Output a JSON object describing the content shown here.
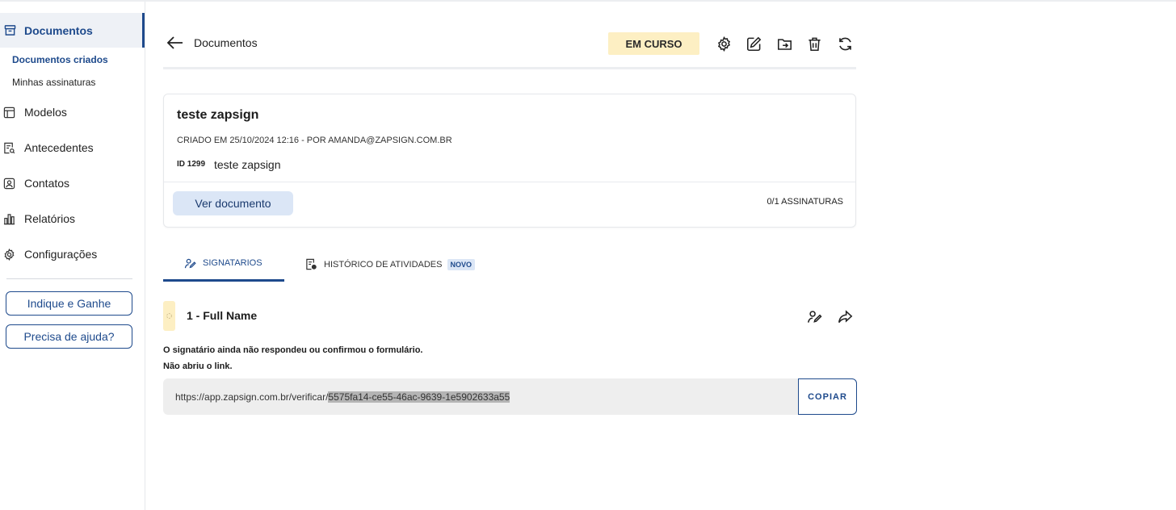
{
  "sidebar": {
    "active": {
      "label": "Documentos",
      "icon": "archive-icon"
    },
    "subitems": [
      {
        "label": "Documentos criados",
        "active": true
      },
      {
        "label": "Minhas assinaturas",
        "active": false
      }
    ],
    "items": [
      {
        "label": "Modelos",
        "icon": "template-icon"
      },
      {
        "label": "Antecedentes",
        "icon": "document-search-icon"
      },
      {
        "label": "Contatos",
        "icon": "contact-icon"
      },
      {
        "label": "Relatórios",
        "icon": "bar-chart-icon"
      },
      {
        "label": "Configurações",
        "icon": "gear-icon"
      }
    ],
    "refer_button": "Indique e Ganhe",
    "help_button": "Precisa de ajuda?"
  },
  "header": {
    "title": "Documentos",
    "status": "EM CURSO",
    "actions": [
      "settings-icon",
      "edit-icon",
      "move-folder-icon",
      "trash-icon",
      "refresh-icon"
    ]
  },
  "document": {
    "name": "teste zapsign",
    "created": "CRIADO EM 25/10/2024 12:16 - POR AMANDA@ZAPSIGN.COM.BR",
    "id_label": "ID 1299",
    "id_value": "teste zapsign",
    "view_button": "Ver documento",
    "signatures": "0/1 ASSINATURAS"
  },
  "tabs": [
    {
      "label": "SIGNATARIOS",
      "icon": "signature-icon",
      "active": true
    },
    {
      "label": "HISTÓRICO DE ATIVIDADES",
      "icon": "history-doc-icon",
      "badge": "NOVO",
      "active": false
    }
  ],
  "signer": {
    "name": "1 - Full Name",
    "message_line1": "O signatário ainda não respondeu ou confirmou o formulário.",
    "message_line2": "Não abriu o link.",
    "link_prefix": "https://app.zapsign.com.br/verificar/",
    "link_token": "5575fa14-ce55-46ac-9639-1e5902633a55",
    "copy_button": "COPIAR"
  },
  "colors": {
    "primary": "#1e4a8c",
    "status_bg": "#fdefc3",
    "button_bg": "#dbe6f6"
  }
}
